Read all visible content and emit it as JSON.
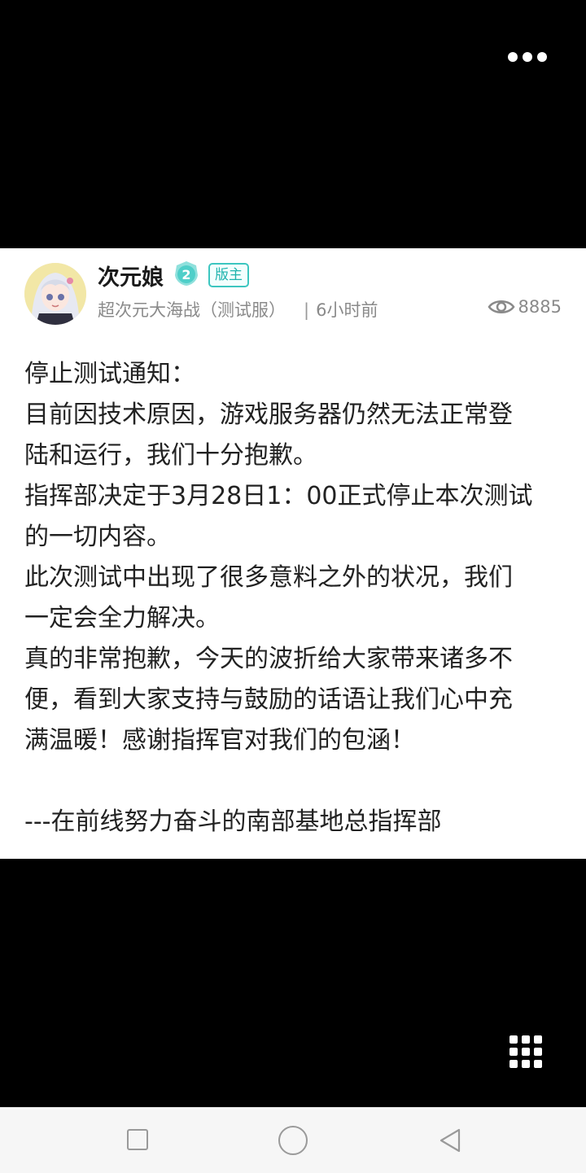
{
  "post": {
    "author": "次元娘",
    "level": "2",
    "role_badge": "版主",
    "forum": "超次元大海战（测试服）",
    "separator": "|",
    "time": "6小时前",
    "views": "8885",
    "body_lines": [
      "停止测试通知：",
      "目前因技术原因，游戏服务器仍然无法正常登",
      "陆和运行，我们十分抱歉。",
      "指挥部决定于3月28日1：00正式停止本次测试",
      "的一切内容。",
      "此次测试中出现了很多意料之外的状况，我们",
      "一定会全力解决。",
      "真的非常抱歉，今天的波折给大家带来诸多不",
      "便，看到大家支持与鼓励的话语让我们心中充",
      "满温暖！感谢指挥官对我们的包涵！",
      "",
      "---在前线努力奋斗的南部基地总指挥部"
    ]
  },
  "colors": {
    "accent": "#3cc6c0",
    "text": "#222222",
    "meta": "#8a8a8a"
  },
  "icons": {
    "more": "more-dots-icon",
    "eye": "eye-icon",
    "grid": "grid-menu-icon",
    "nav_recent": "square-icon",
    "nav_home": "circle-icon",
    "nav_back": "triangle-back-icon"
  }
}
